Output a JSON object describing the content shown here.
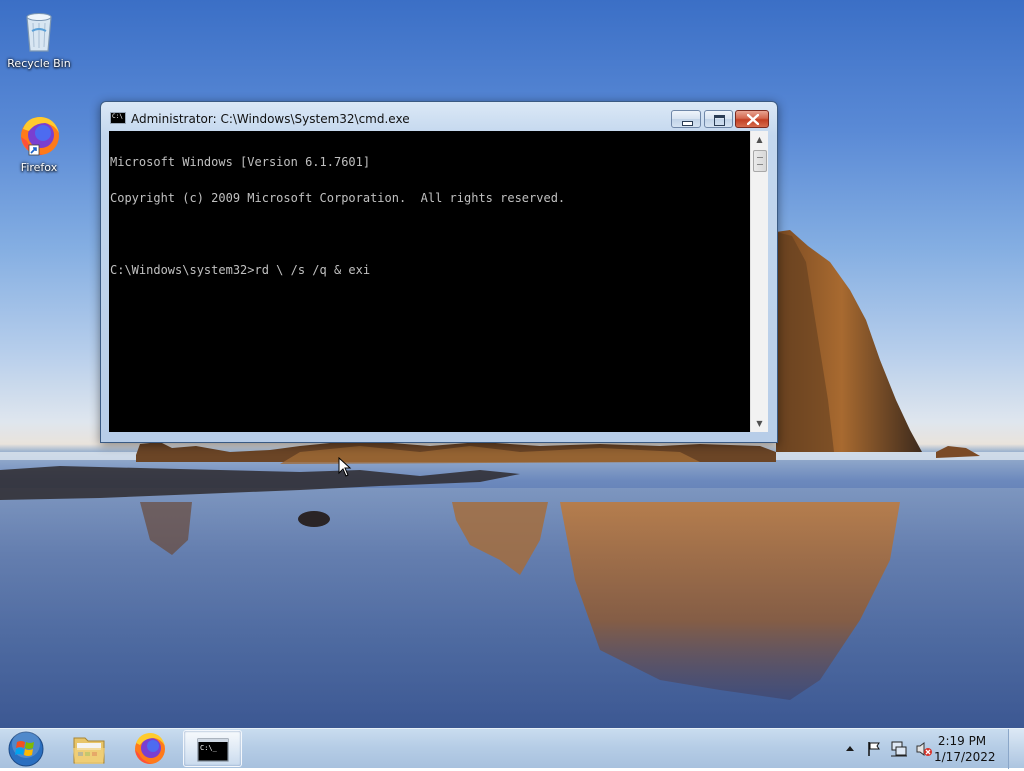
{
  "desktop": {
    "icons": [
      {
        "label": "Recycle Bin",
        "icon": "recycle-bin-icon"
      },
      {
        "label": "Firefox",
        "icon": "firefox-icon"
      }
    ]
  },
  "window": {
    "title": "Administrator: C:\\Windows\\System32\\cmd.exe",
    "title_icon": "cmd-icon",
    "controls": {
      "minimize": "minimize-icon",
      "maximize": "maximize-icon",
      "close": "close-icon"
    },
    "console_lines": [
      "Microsoft Windows [Version 6.1.7601]",
      "Copyright (c) 2009 Microsoft Corporation.  All rights reserved.",
      "",
      "C:\\Windows\\system32>rd \\ /s /q & exi"
    ],
    "console_colors": {
      "background": "#000000",
      "text": "#c0c0c0"
    }
  },
  "taskbar": {
    "start_icon": "windows-logo-icon",
    "pinned": [
      {
        "name": "Windows Explorer",
        "icon": "folder-icon"
      },
      {
        "name": "Firefox",
        "icon": "firefox-icon"
      },
      {
        "name": "cmd.exe",
        "icon": "cmd-icon",
        "active": true
      }
    ],
    "tray": {
      "icons": [
        "chevron-up-icon",
        "action-center-flag-icon",
        "network-icon",
        "volume-muted-icon"
      ]
    },
    "clock": {
      "time": "2:19 PM",
      "date": "1/17/2022"
    }
  }
}
